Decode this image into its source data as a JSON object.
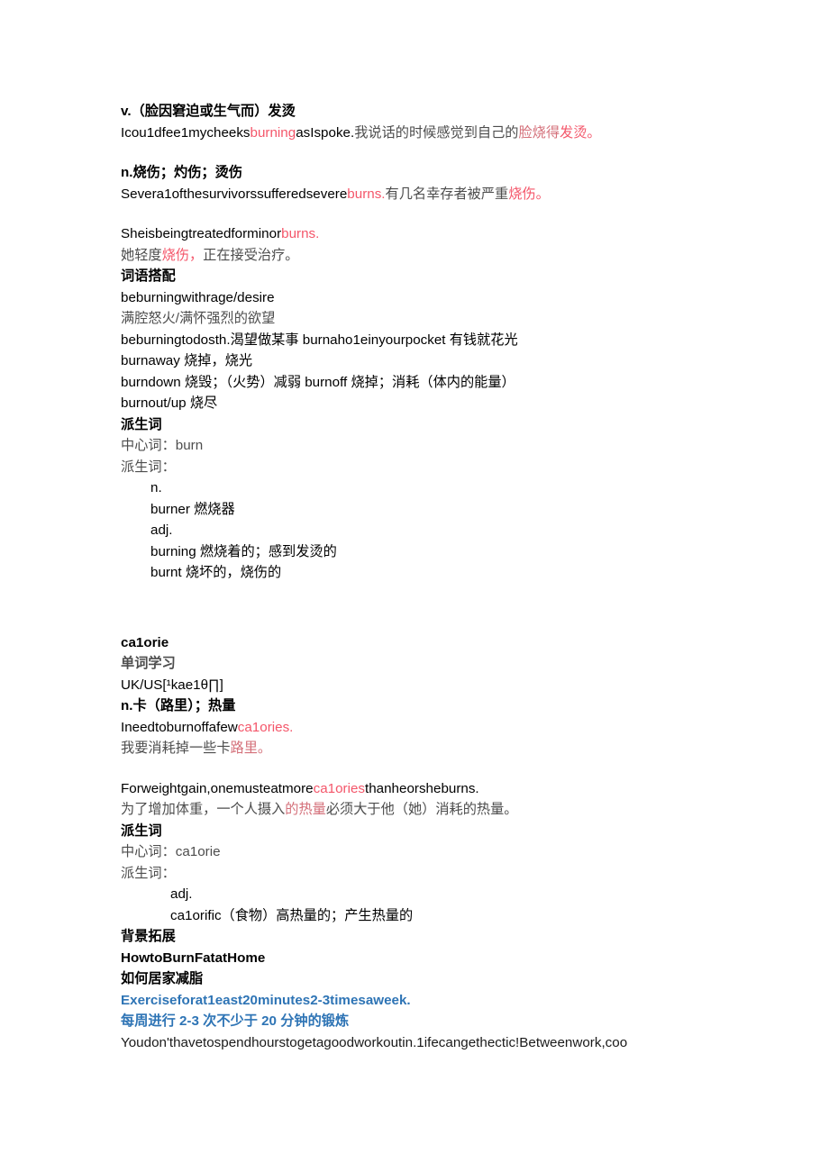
{
  "colors": {
    "highlight_red": "#f4566a",
    "highlight_red_dark": "#d4707a",
    "highlight_blue": "#2e74b5",
    "body_text": "#000000",
    "chinese_gray": "#4d4d4d",
    "page_background": "#ffffff"
  },
  "document": {
    "entry_burn": {
      "sense_v": {
        "pos_and_gloss": "v.（脸因窘迫或生气而）发烫",
        "example_en_pre": "Icou1dfee1mycheeks",
        "example_en_hl": "burning",
        "example_en_post": "asIspoke.",
        "example_cn_pre": "我说话的时候感觉到自己的",
        "example_cn_hl1": "脸烧得",
        "example_cn_hl2": "发烫。"
      },
      "sense_n": {
        "pos_and_gloss": "n.烧伤；灼伤；烫伤",
        "example1_en_pre": "Severa1ofthesurvivorssufferedsevere",
        "example1_en_hl": "burns.",
        "example1_cn_pre": "有几名幸存者被严重",
        "example1_cn_hl": "烧伤。",
        "example2_en_pre": "Sheisbeingtreatedforminor",
        "example2_en_hl": "burns.",
        "example2_cn_pre": "她轻度",
        "example2_cn_hl": "烧伤，",
        "example2_cn_post": "正在接受治疗。"
      },
      "collocations": {
        "heading": "词语搭配",
        "items": [
          "beburningwithrage/desire",
          "满腔怒火/满怀强烈的欲望",
          "beburningtodosth.渴望做某事 burnaho1einyourpocket 有钱就花光",
          "burnaway 烧掉，烧光",
          "burndown 烧毁；（火势）减弱 burnoff 烧掉；消耗（体内的能量）",
          "burnout/up 烧尽"
        ]
      },
      "derivatives": {
        "heading": "派生词",
        "head_label": "中心词：burn",
        "deriv_label": "派生词：",
        "groups": [
          {
            "pos": "n.",
            "words": [
              "burner 燃烧器"
            ]
          },
          {
            "pos": "adj.",
            "words": [
              "burning 燃烧着的；感到发烫的",
              "burnt 烧坏的，烧伤的"
            ]
          }
        ]
      }
    },
    "entry_calorie": {
      "headword": "ca1orie",
      "study_heading": "单词学习",
      "phonetic": "UK/US[¹kae1θ∏]",
      "pos_and_gloss": "n.卡（路里）；热量",
      "example1_en_pre": "Ineedtoburnoffafew",
      "example1_en_hl": "ca1ories.",
      "example1_cn_pre": "我要消耗掉一些卡",
      "example1_cn_hl": "路里。",
      "example2_en_pre": "Forweightgain,onemusteatmore",
      "example2_en_hl": "ca1ories",
      "example2_en_post": "thanheorsheburns.",
      "example2_cn_pre": "为了增加体重，一个人摄入",
      "example2_cn_hl": "的热量",
      "example2_cn_post": "必须大于他（她）消耗的热量。",
      "derivatives": {
        "heading": "派生词",
        "head_label": "中心词：ca1orie",
        "deriv_label": "派生词：",
        "pos": "adj.",
        "word": "ca1orific（食物）高热量的；产生热量的"
      },
      "background": {
        "heading": "背景拓展",
        "title_en": "HowtoBurnFatatHome",
        "title_cn": "如何居家减脂",
        "tip_en": "Exerciseforat1east20minutes2-3timesaweek.",
        "tip_cn": "每周进行 2-3 次不少于 20 分钟的锻炼",
        "body_en": "Youdon'thavetospendhourstogetagoodworkoutin.1ifecangethectic!Betweenwork,coo"
      }
    }
  }
}
